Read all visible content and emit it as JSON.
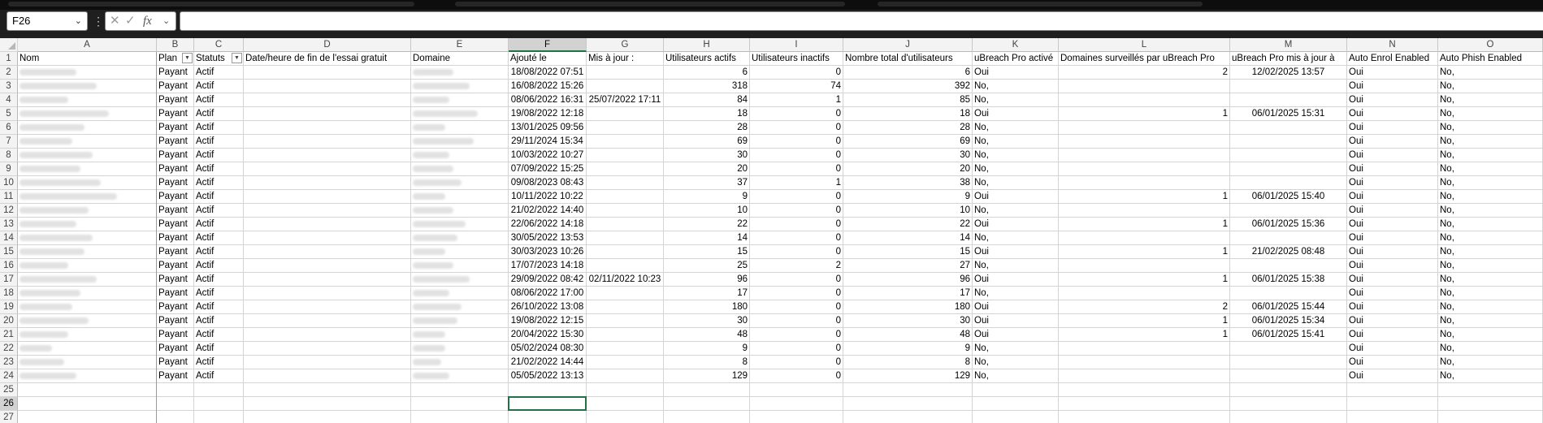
{
  "name_box": {
    "value": "F26"
  },
  "formula_bar": {
    "cancel_glyph": "✕",
    "enter_glyph": "✓",
    "fx_label": "fx",
    "dropdown_glyph": "⌄",
    "more_glyph": "⋮",
    "value": ""
  },
  "column_letters": [
    "A",
    "B",
    "C",
    "D",
    "E",
    "F",
    "G",
    "H",
    "I",
    "J",
    "K",
    "L",
    "M",
    "N",
    "O"
  ],
  "row_numbers": [
    "1",
    "2",
    "3",
    "4",
    "5",
    "6",
    "7",
    "8",
    "9",
    "10",
    "11",
    "12",
    "13",
    "14",
    "15",
    "16",
    "17",
    "18",
    "19",
    "20",
    "21",
    "22",
    "23",
    "24",
    "25",
    "26",
    "27"
  ],
  "active_cell": {
    "column": "F",
    "row": "26"
  },
  "headers": [
    "Nom",
    "Plan",
    "Statuts",
    "Date/heure de fin de l'essai gratuit",
    "Domaine",
    "Ajouté le",
    "Mis à jour :",
    "Utilisateurs actifs",
    "Utilisateurs inactifs",
    "Nombre total d'utilisateurs",
    "uBreach Pro activé",
    "Domaines surveillés par uBreach Pro",
    "uBreach Pro mis à jour à",
    "Auto Enrol Enabled",
    "Auto Phish Enabled"
  ],
  "rows": [
    {
      "plan": "Payant",
      "status": "Actif",
      "added": "18/08/2022 07:51",
      "updated": "",
      "active": "6",
      "inactive": "0",
      "total": "6",
      "ubreach": "Oui",
      "domains": "2",
      "ub_updated": "12/02/2025 13:57",
      "enrol": "Oui",
      "phish": "No,"
    },
    {
      "plan": "Payant",
      "status": "Actif",
      "added": "16/08/2022 15:26",
      "updated": "",
      "active": "318",
      "inactive": "74",
      "total": "392",
      "ubreach": "No,",
      "domains": "",
      "ub_updated": "",
      "enrol": "Oui",
      "phish": "No,"
    },
    {
      "plan": "Payant",
      "status": "Actif",
      "added": "08/06/2022 16:31",
      "updated": "25/07/2022 17:11",
      "active": "84",
      "inactive": "1",
      "total": "85",
      "ubreach": "No,",
      "domains": "",
      "ub_updated": "",
      "enrol": "Oui",
      "phish": "No,"
    },
    {
      "plan": "Payant",
      "status": "Actif",
      "added": "19/08/2022 12:18",
      "updated": "",
      "active": "18",
      "inactive": "0",
      "total": "18",
      "ubreach": "Oui",
      "domains": "1",
      "ub_updated": "06/01/2025 15:31",
      "enrol": "Oui",
      "phish": "No,"
    },
    {
      "plan": "Payant",
      "status": "Actif",
      "added": "13/01/2025 09:56",
      "updated": "",
      "active": "28",
      "inactive": "0",
      "total": "28",
      "ubreach": "No,",
      "domains": "",
      "ub_updated": "",
      "enrol": "Oui",
      "phish": "No,"
    },
    {
      "plan": "Payant",
      "status": "Actif",
      "added": "29/11/2024 15:34",
      "updated": "",
      "active": "69",
      "inactive": "0",
      "total": "69",
      "ubreach": "No,",
      "domains": "",
      "ub_updated": "",
      "enrol": "Oui",
      "phish": "No,"
    },
    {
      "plan": "Payant",
      "status": "Actif",
      "added": "10/03/2022 10:27",
      "updated": "",
      "active": "30",
      "inactive": "0",
      "total": "30",
      "ubreach": "No,",
      "domains": "",
      "ub_updated": "",
      "enrol": "Oui",
      "phish": "No,"
    },
    {
      "plan": "Payant",
      "status": "Actif",
      "added": "07/09/2022 15:25",
      "updated": "",
      "active": "20",
      "inactive": "0",
      "total": "20",
      "ubreach": "No,",
      "domains": "",
      "ub_updated": "",
      "enrol": "Oui",
      "phish": "No,"
    },
    {
      "plan": "Payant",
      "status": "Actif",
      "added": "09/08/2023 08:43",
      "updated": "",
      "active": "37",
      "inactive": "1",
      "total": "38",
      "ubreach": "No,",
      "domains": "",
      "ub_updated": "",
      "enrol": "Oui",
      "phish": "No,"
    },
    {
      "plan": "Payant",
      "status": "Actif",
      "added": "10/11/2022 10:22",
      "updated": "",
      "active": "9",
      "inactive": "0",
      "total": "9",
      "ubreach": "Oui",
      "domains": "1",
      "ub_updated": "06/01/2025 15:40",
      "enrol": "Oui",
      "phish": "No,"
    },
    {
      "plan": "Payant",
      "status": "Actif",
      "added": "21/02/2022 14:40",
      "updated": "",
      "active": "10",
      "inactive": "0",
      "total": "10",
      "ubreach": "No,",
      "domains": "",
      "ub_updated": "",
      "enrol": "Oui",
      "phish": "No,"
    },
    {
      "plan": "Payant",
      "status": "Actif",
      "added": "22/06/2022 14:18",
      "updated": "",
      "active": "22",
      "inactive": "0",
      "total": "22",
      "ubreach": "Oui",
      "domains": "1",
      "ub_updated": "06/01/2025 15:36",
      "enrol": "Oui",
      "phish": "No,"
    },
    {
      "plan": "Payant",
      "status": "Actif",
      "added": "30/05/2022 13:53",
      "updated": "",
      "active": "14",
      "inactive": "0",
      "total": "14",
      "ubreach": "No,",
      "domains": "",
      "ub_updated": "",
      "enrol": "Oui",
      "phish": "No,"
    },
    {
      "plan": "Payant",
      "status": "Actif",
      "added": "30/03/2023 10:26",
      "updated": "",
      "active": "15",
      "inactive": "0",
      "total": "15",
      "ubreach": "Oui",
      "domains": "1",
      "ub_updated": "21/02/2025 08:48",
      "enrol": "Oui",
      "phish": "No,"
    },
    {
      "plan": "Payant",
      "status": "Actif",
      "added": "17/07/2023 14:18",
      "updated": "",
      "active": "25",
      "inactive": "2",
      "total": "27",
      "ubreach": "No,",
      "domains": "",
      "ub_updated": "",
      "enrol": "Oui",
      "phish": "No,"
    },
    {
      "plan": "Payant",
      "status": "Actif",
      "added": "29/09/2022 08:42",
      "updated": "02/11/2022 10:23",
      "active": "96",
      "inactive": "0",
      "total": "96",
      "ubreach": "Oui",
      "domains": "1",
      "ub_updated": "06/01/2025 15:38",
      "enrol": "Oui",
      "phish": "No,"
    },
    {
      "plan": "Payant",
      "status": "Actif",
      "added": "08/06/2022 17:00",
      "updated": "",
      "active": "17",
      "inactive": "0",
      "total": "17",
      "ubreach": "No,",
      "domains": "",
      "ub_updated": "",
      "enrol": "Oui",
      "phish": "No,"
    },
    {
      "plan": "Payant",
      "status": "Actif",
      "added": "26/10/2022 13:08",
      "updated": "",
      "active": "180",
      "inactive": "0",
      "total": "180",
      "ubreach": "Oui",
      "domains": "2",
      "ub_updated": "06/01/2025 15:44",
      "enrol": "Oui",
      "phish": "No,"
    },
    {
      "plan": "Payant",
      "status": "Actif",
      "added": "19/08/2022 12:15",
      "updated": "",
      "active": "30",
      "inactive": "0",
      "total": "30",
      "ubreach": "Oui",
      "domains": "1",
      "ub_updated": "06/01/2025 15:34",
      "enrol": "Oui",
      "phish": "No,"
    },
    {
      "plan": "Payant",
      "status": "Actif",
      "added": "20/04/2022 15:30",
      "updated": "",
      "active": "48",
      "inactive": "0",
      "total": "48",
      "ubreach": "Oui",
      "domains": "1",
      "ub_updated": "06/01/2025 15:41",
      "enrol": "Oui",
      "phish": "No,"
    },
    {
      "plan": "Payant",
      "status": "Actif",
      "added": "05/02/2024 08:30",
      "updated": "",
      "active": "9",
      "inactive": "0",
      "total": "9",
      "ubreach": "No,",
      "domains": "",
      "ub_updated": "",
      "enrol": "Oui",
      "phish": "No,"
    },
    {
      "plan": "Payant",
      "status": "Actif",
      "added": "21/02/2022 14:44",
      "updated": "",
      "active": "8",
      "inactive": "0",
      "total": "8",
      "ubreach": "No,",
      "domains": "",
      "ub_updated": "",
      "enrol": "Oui",
      "phish": "No,"
    },
    {
      "plan": "Payant",
      "status": "Actif",
      "added": "05/05/2022 13:13",
      "updated": "",
      "active": "129",
      "inactive": "0",
      "total": "129",
      "ubreach": "No,",
      "domains": "",
      "ub_updated": "",
      "enrol": "Oui",
      "phish": "No,"
    }
  ]
}
